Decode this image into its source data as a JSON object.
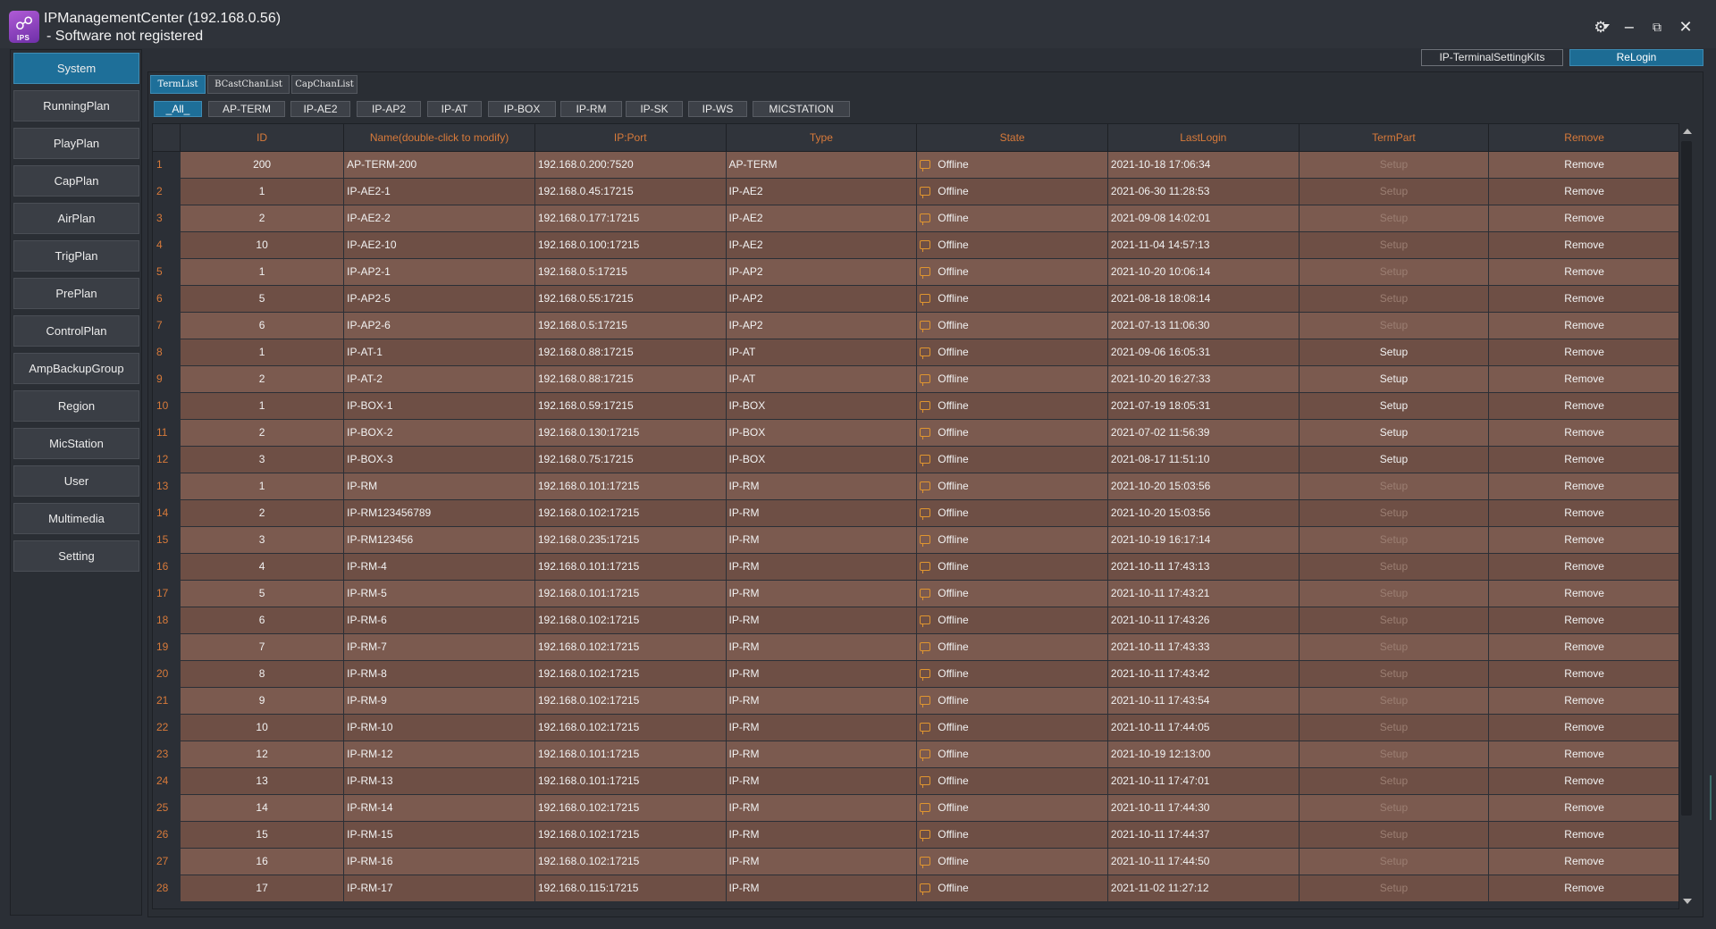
{
  "app": {
    "title": "IPManagementCenter (192.168.0.56)",
    "subtitle": "- Software not registered",
    "logo_tag": "IPS",
    "logo_icon": "network-users-icon"
  },
  "window_controls": {
    "settings_icon": "⚙",
    "minimize_icon": "−",
    "restore_icon": "⧉",
    "close_icon": "✕"
  },
  "top_buttons": {
    "kits": "IP-TerminalSettingKits",
    "relogin": "ReLogin"
  },
  "sidebar": {
    "items": [
      {
        "label": "System",
        "active": true
      },
      {
        "label": "RunningPlan"
      },
      {
        "label": "PlayPlan"
      },
      {
        "label": "CapPlan"
      },
      {
        "label": "AirPlan"
      },
      {
        "label": "TrigPlan"
      },
      {
        "label": "PrePlan"
      },
      {
        "label": "ControlPlan"
      },
      {
        "label": "AmpBackupGroup"
      },
      {
        "label": "Region"
      },
      {
        "label": "MicStation"
      },
      {
        "label": "User"
      },
      {
        "label": "Multimedia"
      },
      {
        "label": "Setting"
      }
    ]
  },
  "tabs": [
    {
      "label": "TermList",
      "active": true
    },
    {
      "label": "BCastChanList"
    },
    {
      "label": "CapChanList"
    }
  ],
  "filters": [
    {
      "label": "_All_",
      "active": true
    },
    {
      "label": "AP-TERM"
    },
    {
      "label": "IP-AE2"
    },
    {
      "label": "IP-AP2"
    },
    {
      "label": "IP-AT"
    },
    {
      "label": "IP-BOX"
    },
    {
      "label": "IP-RM"
    },
    {
      "label": "IP-SK"
    },
    {
      "label": "IP-WS"
    },
    {
      "label": "MICSTATION"
    }
  ],
  "table": {
    "columns": [
      "ID",
      "Name(double-click to modify)",
      "IP:Port",
      "Type",
      "State",
      "LastLogin",
      "TermPart",
      "Remove"
    ],
    "rows": [
      {
        "n": "1",
        "id": "200",
        "name": "AP-TERM-200",
        "ip": "192.168.0.200:7520",
        "type": "AP-TERM",
        "state": "Offline",
        "last": "2021-10-18 17:06:34",
        "term": "Setup",
        "remove": "Remove",
        "setup_enabled": false
      },
      {
        "n": "2",
        "id": "1",
        "name": "IP-AE2-1",
        "ip": "192.168.0.45:17215",
        "type": "IP-AE2",
        "state": "Offline",
        "last": "2021-06-30 11:28:53",
        "term": "Setup",
        "remove": "Remove",
        "setup_enabled": false
      },
      {
        "n": "3",
        "id": "2",
        "name": "IP-AE2-2",
        "ip": "192.168.0.177:17215",
        "type": "IP-AE2",
        "state": "Offline",
        "last": "2021-09-08 14:02:01",
        "term": "Setup",
        "remove": "Remove",
        "setup_enabled": false
      },
      {
        "n": "4",
        "id": "10",
        "name": "IP-AE2-10",
        "ip": "192.168.0.100:17215",
        "type": "IP-AE2",
        "state": "Offline",
        "last": "2021-11-04 14:57:13",
        "term": "Setup",
        "remove": "Remove",
        "setup_enabled": false
      },
      {
        "n": "5",
        "id": "1",
        "name": "IP-AP2-1",
        "ip": "192.168.0.5:17215",
        "type": "IP-AP2",
        "state": "Offline",
        "last": "2021-10-20 10:06:14",
        "term": "Setup",
        "remove": "Remove",
        "setup_enabled": false
      },
      {
        "n": "6",
        "id": "5",
        "name": "IP-AP2-5",
        "ip": "192.168.0.55:17215",
        "type": "IP-AP2",
        "state": "Offline",
        "last": "2021-08-18 18:08:14",
        "term": "Setup",
        "remove": "Remove",
        "setup_enabled": false
      },
      {
        "n": "7",
        "id": "6",
        "name": "IP-AP2-6",
        "ip": "192.168.0.5:17215",
        "type": "IP-AP2",
        "state": "Offline",
        "last": "2021-07-13 11:06:30",
        "term": "Setup",
        "remove": "Remove",
        "setup_enabled": false
      },
      {
        "n": "8",
        "id": "1",
        "name": "IP-AT-1",
        "ip": "192.168.0.88:17215",
        "type": "IP-AT",
        "state": "Offline",
        "last": "2021-09-06 16:05:31",
        "term": "Setup",
        "remove": "Remove",
        "setup_enabled": true
      },
      {
        "n": "9",
        "id": "2",
        "name": "IP-AT-2",
        "ip": "192.168.0.88:17215",
        "type": "IP-AT",
        "state": "Offline",
        "last": "2021-10-20 16:27:33",
        "term": "Setup",
        "remove": "Remove",
        "setup_enabled": true
      },
      {
        "n": "10",
        "id": "1",
        "name": "IP-BOX-1",
        "ip": "192.168.0.59:17215",
        "type": "IP-BOX",
        "state": "Offline",
        "last": "2021-07-19 18:05:31",
        "term": "Setup",
        "remove": "Remove",
        "setup_enabled": true
      },
      {
        "n": "11",
        "id": "2",
        "name": "IP-BOX-2",
        "ip": "192.168.0.130:17215",
        "type": "IP-BOX",
        "state": "Offline",
        "last": "2021-07-02 11:56:39",
        "term": "Setup",
        "remove": "Remove",
        "setup_enabled": true
      },
      {
        "n": "12",
        "id": "3",
        "name": "IP-BOX-3",
        "ip": "192.168.0.75:17215",
        "type": "IP-BOX",
        "state": "Offline",
        "last": "2021-08-17 11:51:10",
        "term": "Setup",
        "remove": "Remove",
        "setup_enabled": true
      },
      {
        "n": "13",
        "id": "1",
        "name": "IP-RM",
        "ip": "192.168.0.101:17215",
        "type": "IP-RM",
        "state": "Offline",
        "last": "2021-10-20 15:03:56",
        "term": "Setup",
        "remove": "Remove",
        "setup_enabled": false
      },
      {
        "n": "14",
        "id": "2",
        "name": "IP-RM123456789",
        "ip": "192.168.0.102:17215",
        "type": "IP-RM",
        "state": "Offline",
        "last": "2021-10-20 15:03:56",
        "term": "Setup",
        "remove": "Remove",
        "setup_enabled": false
      },
      {
        "n": "15",
        "id": "3",
        "name": "IP-RM123456",
        "ip": "192.168.0.235:17215",
        "type": "IP-RM",
        "state": "Offline",
        "last": "2021-10-19 16:17:14",
        "term": "Setup",
        "remove": "Remove",
        "setup_enabled": false
      },
      {
        "n": "16",
        "id": "4",
        "name": "IP-RM-4",
        "ip": "192.168.0.101:17215",
        "type": "IP-RM",
        "state": "Offline",
        "last": "2021-10-11 17:43:13",
        "term": "Setup",
        "remove": "Remove",
        "setup_enabled": false
      },
      {
        "n": "17",
        "id": "5",
        "name": "IP-RM-5",
        "ip": "192.168.0.101:17215",
        "type": "IP-RM",
        "state": "Offline",
        "last": "2021-10-11 17:43:21",
        "term": "Setup",
        "remove": "Remove",
        "setup_enabled": false
      },
      {
        "n": "18",
        "id": "6",
        "name": "IP-RM-6",
        "ip": "192.168.0.102:17215",
        "type": "IP-RM",
        "state": "Offline",
        "last": "2021-10-11 17:43:26",
        "term": "Setup",
        "remove": "Remove",
        "setup_enabled": false
      },
      {
        "n": "19",
        "id": "7",
        "name": "IP-RM-7",
        "ip": "192.168.0.102:17215",
        "type": "IP-RM",
        "state": "Offline",
        "last": "2021-10-11 17:43:33",
        "term": "Setup",
        "remove": "Remove",
        "setup_enabled": false
      },
      {
        "n": "20",
        "id": "8",
        "name": "IP-RM-8",
        "ip": "192.168.0.102:17215",
        "type": "IP-RM",
        "state": "Offline",
        "last": "2021-10-11 17:43:42",
        "term": "Setup",
        "remove": "Remove",
        "setup_enabled": false
      },
      {
        "n": "21",
        "id": "9",
        "name": "IP-RM-9",
        "ip": "192.168.0.102:17215",
        "type": "IP-RM",
        "state": "Offline",
        "last": "2021-10-11 17:43:54",
        "term": "Setup",
        "remove": "Remove",
        "setup_enabled": false
      },
      {
        "n": "22",
        "id": "10",
        "name": "IP-RM-10",
        "ip": "192.168.0.102:17215",
        "type": "IP-RM",
        "state": "Offline",
        "last": "2021-10-11 17:44:05",
        "term": "Setup",
        "remove": "Remove",
        "setup_enabled": false
      },
      {
        "n": "23",
        "id": "12",
        "name": "IP-RM-12",
        "ip": "192.168.0.101:17215",
        "type": "IP-RM",
        "state": "Offline",
        "last": "2021-10-19 12:13:00",
        "term": "Setup",
        "remove": "Remove",
        "setup_enabled": false
      },
      {
        "n": "24",
        "id": "13",
        "name": "IP-RM-13",
        "ip": "192.168.0.101:17215",
        "type": "IP-RM",
        "state": "Offline",
        "last": "2021-10-11 17:47:01",
        "term": "Setup",
        "remove": "Remove",
        "setup_enabled": false
      },
      {
        "n": "25",
        "id": "14",
        "name": "IP-RM-14",
        "ip": "192.168.0.102:17215",
        "type": "IP-RM",
        "state": "Offline",
        "last": "2021-10-11 17:44:30",
        "term": "Setup",
        "remove": "Remove",
        "setup_enabled": false
      },
      {
        "n": "26",
        "id": "15",
        "name": "IP-RM-15",
        "ip": "192.168.0.102:17215",
        "type": "IP-RM",
        "state": "Offline",
        "last": "2021-10-11 17:44:37",
        "term": "Setup",
        "remove": "Remove",
        "setup_enabled": false
      },
      {
        "n": "27",
        "id": "16",
        "name": "IP-RM-16",
        "ip": "192.168.0.102:17215",
        "type": "IP-RM",
        "state": "Offline",
        "last": "2021-10-11 17:44:50",
        "term": "Setup",
        "remove": "Remove",
        "setup_enabled": false
      },
      {
        "n": "28",
        "id": "17",
        "name": "IP-RM-17",
        "ip": "192.168.0.115:17215",
        "type": "IP-RM",
        "state": "Offline",
        "last": "2021-11-02 11:27:12",
        "term": "Setup",
        "remove": "Remove",
        "setup_enabled": false
      }
    ]
  },
  "colors": {
    "accent": "#1e6f99",
    "header_text": "#d87a3a",
    "row": "#7b5a4f",
    "row_alt": "#6e4f45",
    "offline_icon": "#e0952f"
  },
  "icons": {
    "state": "monitor-offline-icon",
    "scroll_up": "scroll-up-arrow-icon",
    "scroll_down": "scroll-down-arrow-icon"
  }
}
